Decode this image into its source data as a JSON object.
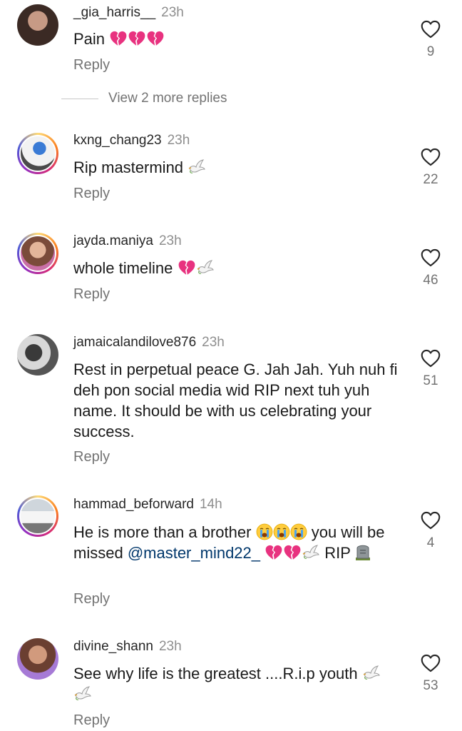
{
  "comments": [
    {
      "username": "_gia_harris__",
      "time": "23h",
      "text": "Pain",
      "emojis": [
        "broken-heart",
        "broken-heart",
        "broken-heart"
      ],
      "reply_label": "Reply",
      "likes": "9"
    },
    {
      "username": "kxng_chang23",
      "time": "23h",
      "text": "Rip mastermind",
      "emojis": [
        "dove"
      ],
      "reply_label": "Reply",
      "likes": "22"
    },
    {
      "username": "jayda.maniya",
      "time": "23h",
      "text": "whole timeline",
      "emojis": [
        "broken-heart",
        "dove"
      ],
      "reply_label": "Reply",
      "likes": "46"
    },
    {
      "username": "jamaicalandilove876",
      "time": "23h",
      "text": "Rest in perpetual peace G. Jah Jah. Yuh nuh fi deh pon social media wid RIP next tuh yuh name. It should be with us celebrating your success.",
      "reply_label": "Reply",
      "likes": "51"
    },
    {
      "username": "hammad_beforward",
      "time": "14h",
      "text_before": "He is more than a brother",
      "text_after": "you will be missed",
      "mention": "@master_mind22_",
      "text_end": "RIP",
      "emojis": [
        "crying-face",
        "crying-face",
        "crying-face",
        "broken-heart",
        "broken-heart",
        "dove",
        "headstone"
      ],
      "reply_label": "Reply",
      "likes": "4"
    },
    {
      "username": "divine_shann",
      "time": "23h",
      "text": "See why life is the greatest ....R.i.p youth",
      "emojis": [
        "dove",
        "dove"
      ],
      "reply_label": "Reply",
      "likes": "53"
    }
  ],
  "view_more_replies": "View 2 more replies",
  "colors": {
    "text": "#262626",
    "secondary": "#737373",
    "mention": "#00376b",
    "broken_heart": "#e8327f"
  },
  "icons": [
    "heart-outline-icon",
    "broken-heart-emoji",
    "dove-emoji",
    "crying-face-emoji",
    "headstone-emoji"
  ]
}
